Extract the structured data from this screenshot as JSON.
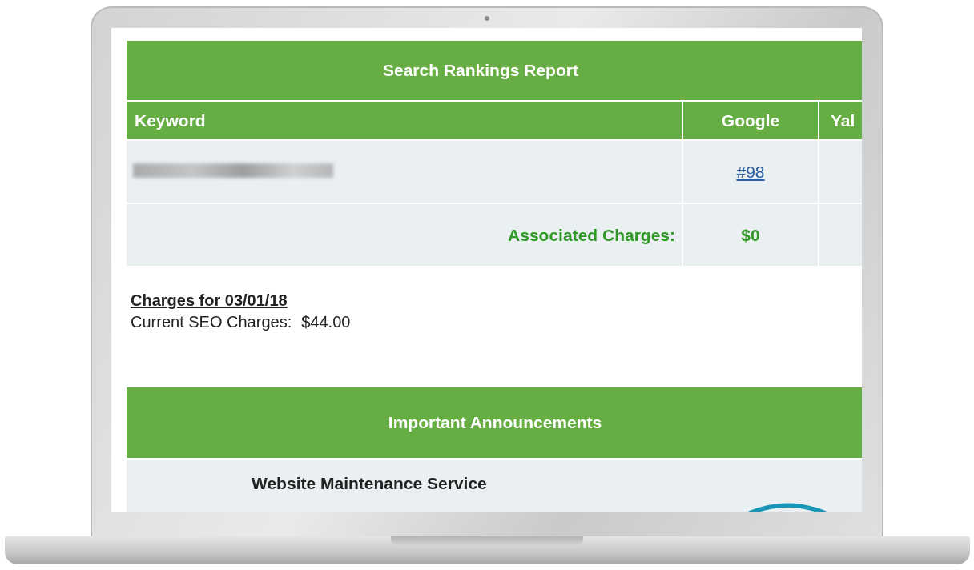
{
  "report": {
    "title": "Search Rankings Report",
    "columns": [
      "Keyword",
      "Google",
      "Yal"
    ],
    "rows": [
      {
        "keyword": {
          "kind": "redacted"
        },
        "google": "#98"
      }
    ],
    "charges_row": {
      "label": "Associated Charges:",
      "google": "$0"
    }
  },
  "charges": {
    "heading": "Charges for 03/01/18",
    "label": "Current SEO Charges:",
    "amount": "$44.00"
  },
  "announcements": {
    "title": "Important Announcements",
    "items": [
      {
        "title": "Website Maintenance Service"
      }
    ]
  }
}
